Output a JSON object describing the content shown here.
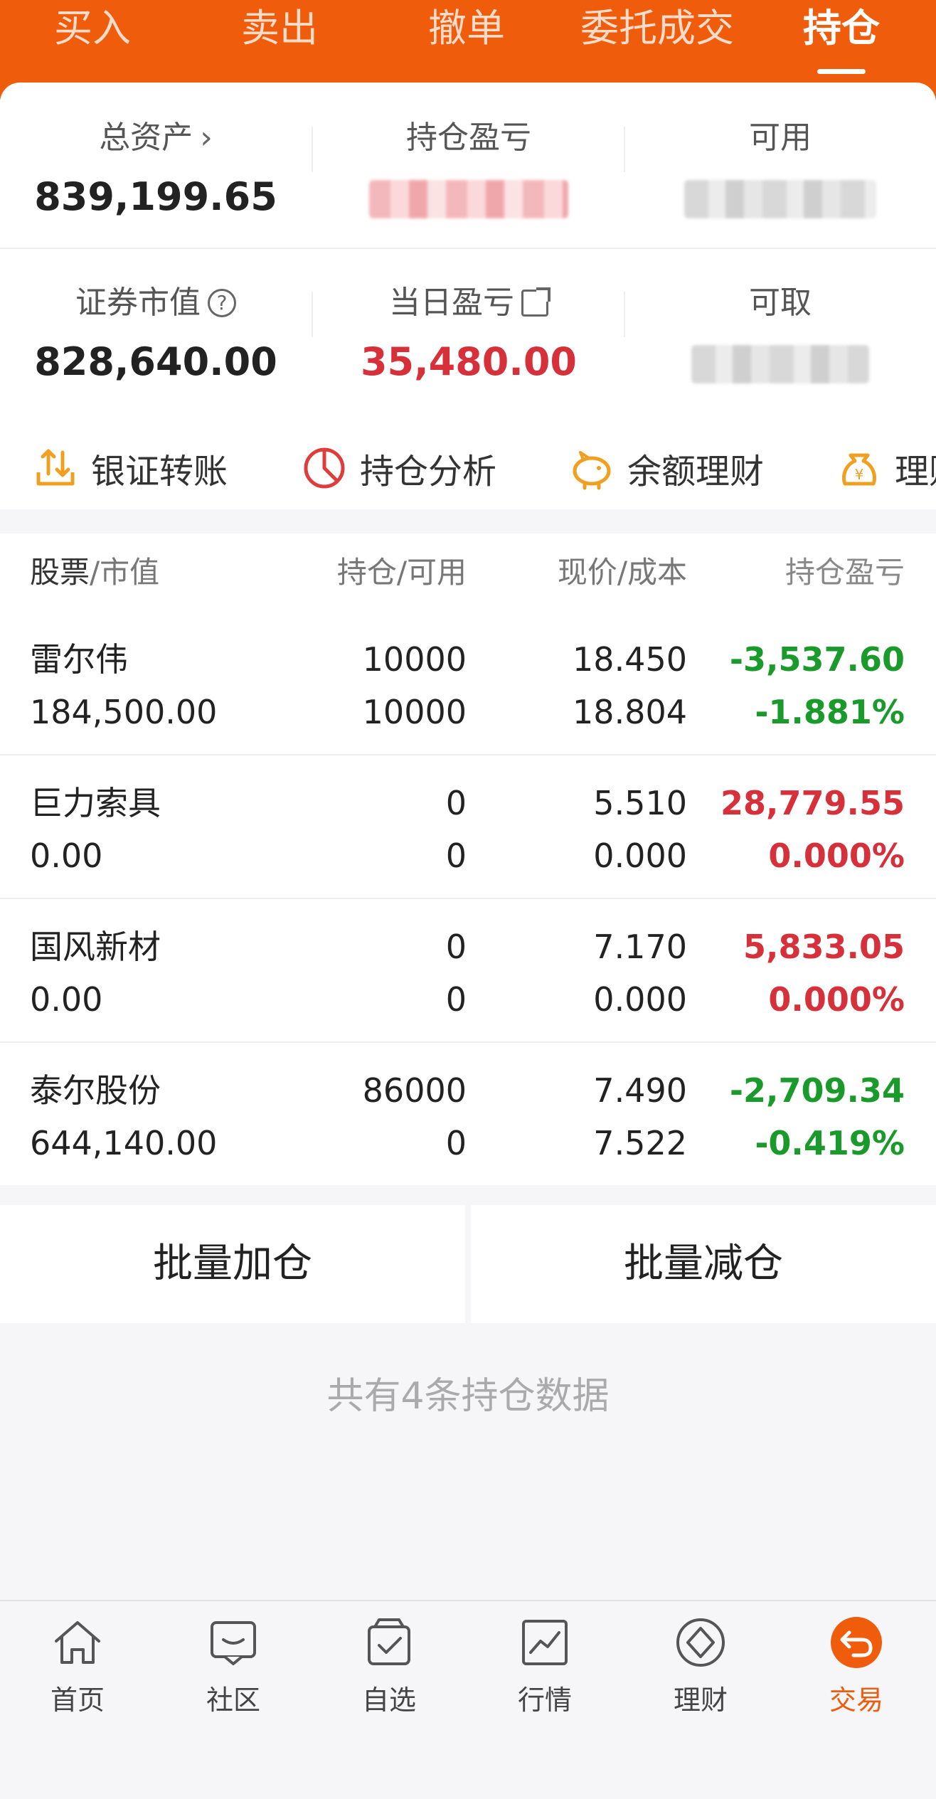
{
  "tabs": [
    {
      "label": "买入",
      "active": false
    },
    {
      "label": "卖出",
      "active": false
    },
    {
      "label": "撤单",
      "active": false
    },
    {
      "label": "委托成交",
      "active": false
    },
    {
      "label": "持仓",
      "active": true
    }
  ],
  "summary": {
    "total_assets_label": "总资产",
    "total_assets_value": "839,199.65",
    "position_pl_label": "持仓盈亏",
    "available_label": "可用",
    "market_value_label": "证券市值",
    "market_value_value": "828,640.00",
    "daily_pl_label": "当日盈亏",
    "daily_pl_value": "35,480.00",
    "withdrawable_label": "可取"
  },
  "quick_actions": [
    {
      "label": "银证转账",
      "icon": "transfer-icon"
    },
    {
      "label": "持仓分析",
      "icon": "pie-chart-icon"
    },
    {
      "label": "余额理财",
      "icon": "piggy-bank-icon"
    },
    {
      "label": "理财",
      "icon": "money-bag-icon"
    }
  ],
  "table": {
    "headers": {
      "stock": "股票",
      "market_value": "/市值",
      "position": "持仓/可用",
      "price": "现价/成本",
      "pl": "持仓盈亏"
    },
    "rows": [
      {
        "name": "雷尔伟",
        "market_value": "184,500.00",
        "position": "10000",
        "available": "10000",
        "price": "18.450",
        "cost": "18.804",
        "pl": "-3,537.60",
        "pl_pct": "-1.881%",
        "status": "loss"
      },
      {
        "name": "巨力索具",
        "market_value": "0.00",
        "position": "0",
        "available": "0",
        "price": "5.510",
        "cost": "0.000",
        "pl": "28,779.55",
        "pl_pct": "0.000%",
        "status": "gain"
      },
      {
        "name": "国风新材",
        "market_value": "0.00",
        "position": "0",
        "available": "0",
        "price": "7.170",
        "cost": "0.000",
        "pl": "5,833.05",
        "pl_pct": "0.000%",
        "status": "gain"
      },
      {
        "name": "泰尔股份",
        "market_value": "644,140.00",
        "position": "86000",
        "available": "0",
        "price": "7.490",
        "cost": "7.522",
        "pl": "-2,709.34",
        "pl_pct": "-0.419%",
        "status": "loss"
      }
    ]
  },
  "batch": {
    "add_label": "批量加仓",
    "reduce_label": "批量减仓"
  },
  "footer_note": "共有4条持仓数据",
  "bottom_nav": [
    {
      "label": "首页",
      "icon": "home-icon",
      "active": false
    },
    {
      "label": "社区",
      "icon": "community-icon",
      "active": false
    },
    {
      "label": "自选",
      "icon": "watchlist-icon",
      "active": false
    },
    {
      "label": "行情",
      "icon": "market-icon",
      "active": false
    },
    {
      "label": "理财",
      "icon": "wealth-icon",
      "active": false
    },
    {
      "label": "交易",
      "icon": "trade-icon",
      "active": true
    }
  ],
  "colors": {
    "brand": "#ee5c0c",
    "gain": "#d6303a",
    "loss": "#1a9a2a"
  }
}
